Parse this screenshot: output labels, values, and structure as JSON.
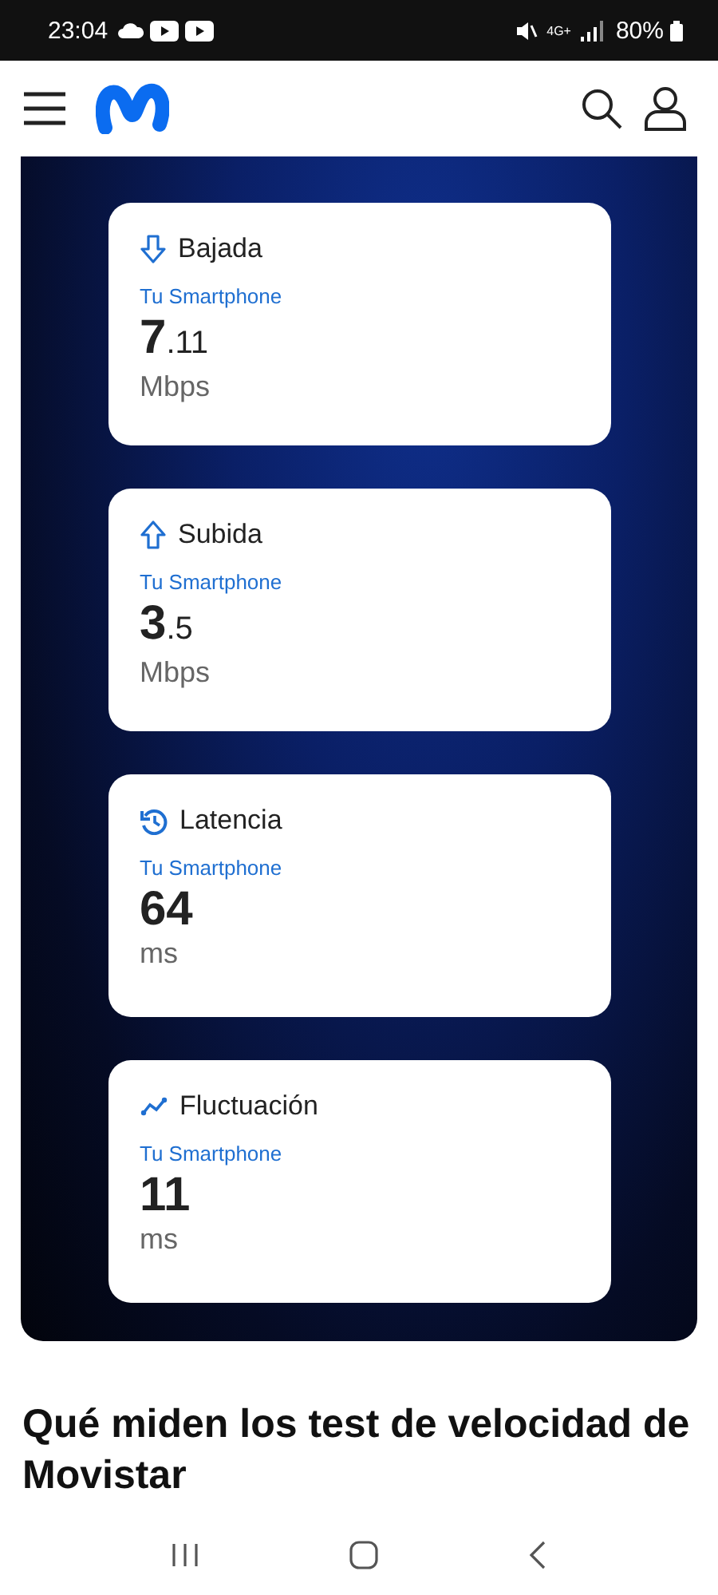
{
  "status_bar": {
    "time": "23:04",
    "network": "4G+",
    "battery": "80%"
  },
  "cards": [
    {
      "kind": "download",
      "title": "Bajada",
      "subtitle": "Tu Smartphone",
      "value_int": "7",
      "value_dec": ".11",
      "unit": "Mbps"
    },
    {
      "kind": "upload",
      "title": "Subida",
      "subtitle": "Tu Smartphone",
      "value_int": "3",
      "value_dec": ".5",
      "unit": "Mbps"
    },
    {
      "kind": "latency",
      "title": "Latencia",
      "subtitle": "Tu Smartphone",
      "value_int": "64",
      "unit": "ms"
    },
    {
      "kind": "jitter",
      "title": "Fluctuación",
      "subtitle": "Tu Smartphone",
      "value_int": "11",
      "unit": "ms"
    }
  ],
  "heading": "Qué miden los test de velocidad de Movistar"
}
